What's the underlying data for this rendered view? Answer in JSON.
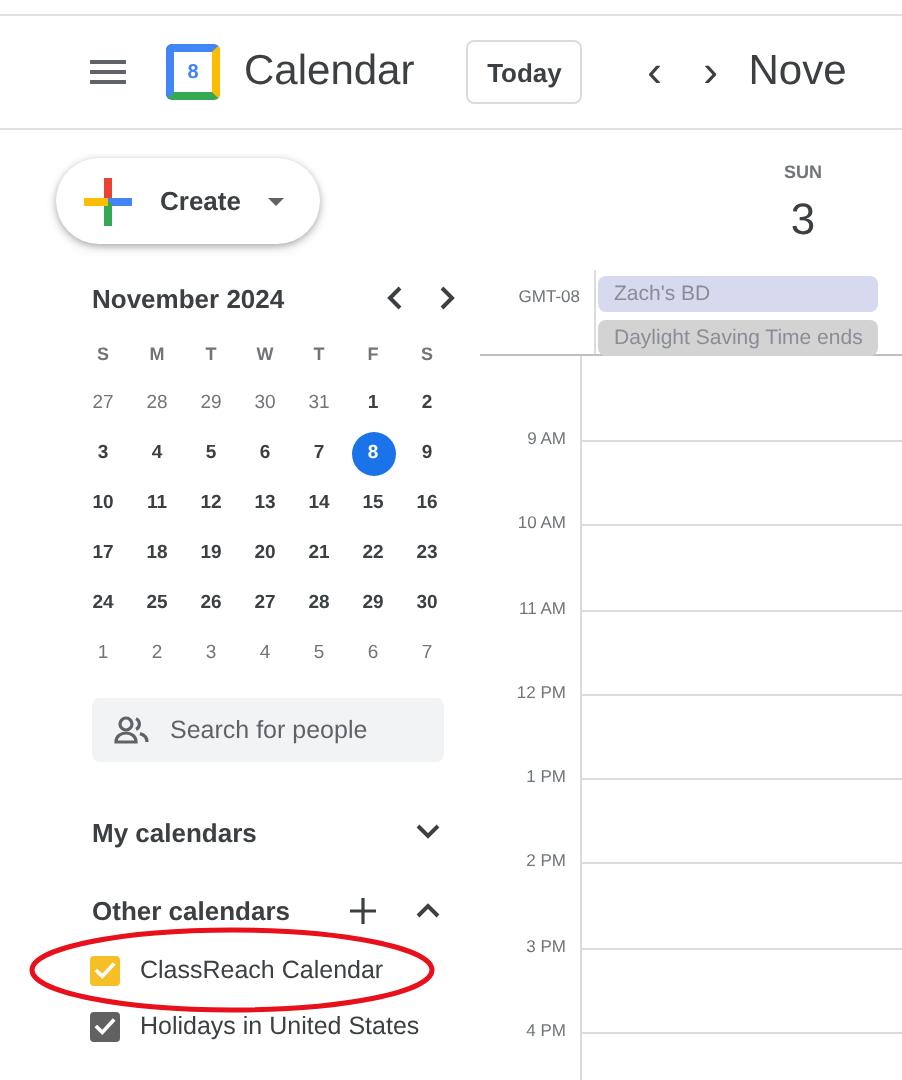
{
  "header": {
    "app_name": "Calendar",
    "logo_day": "8",
    "today_button": "Today",
    "prev": "‹",
    "next": "›",
    "period": "Nove"
  },
  "create_button": "Create",
  "mini_calendar": {
    "title": "November 2024",
    "weekdays": [
      "S",
      "M",
      "T",
      "W",
      "T",
      "F",
      "S"
    ],
    "weeks": [
      [
        {
          "d": "27",
          "other_month": true,
          "selected": false
        },
        {
          "d": "28",
          "other_month": true,
          "selected": false
        },
        {
          "d": "29",
          "other_month": true,
          "selected": false
        },
        {
          "d": "30",
          "other_month": true,
          "selected": false
        },
        {
          "d": "31",
          "other_month": true,
          "selected": false
        },
        {
          "d": "1",
          "other_month": false,
          "selected": false
        },
        {
          "d": "2",
          "other_month": false,
          "selected": false
        }
      ],
      [
        {
          "d": "3",
          "other_month": false,
          "selected": false
        },
        {
          "d": "4",
          "other_month": false,
          "selected": false
        },
        {
          "d": "5",
          "other_month": false,
          "selected": false
        },
        {
          "d": "6",
          "other_month": false,
          "selected": false
        },
        {
          "d": "7",
          "other_month": false,
          "selected": false
        },
        {
          "d": "8",
          "other_month": false,
          "selected": true
        },
        {
          "d": "9",
          "other_month": false,
          "selected": false
        }
      ],
      [
        {
          "d": "10",
          "other_month": false,
          "selected": false
        },
        {
          "d": "11",
          "other_month": false,
          "selected": false
        },
        {
          "d": "12",
          "other_month": false,
          "selected": false
        },
        {
          "d": "13",
          "other_month": false,
          "selected": false
        },
        {
          "d": "14",
          "other_month": false,
          "selected": false
        },
        {
          "d": "15",
          "other_month": false,
          "selected": false
        },
        {
          "d": "16",
          "other_month": false,
          "selected": false
        }
      ],
      [
        {
          "d": "17",
          "other_month": false,
          "selected": false
        },
        {
          "d": "18",
          "other_month": false,
          "selected": false
        },
        {
          "d": "19",
          "other_month": false,
          "selected": false
        },
        {
          "d": "20",
          "other_month": false,
          "selected": false
        },
        {
          "d": "21",
          "other_month": false,
          "selected": false
        },
        {
          "d": "22",
          "other_month": false,
          "selected": false
        },
        {
          "d": "23",
          "other_month": false,
          "selected": false
        }
      ],
      [
        {
          "d": "24",
          "other_month": false,
          "selected": false
        },
        {
          "d": "25",
          "other_month": false,
          "selected": false
        },
        {
          "d": "26",
          "other_month": false,
          "selected": false
        },
        {
          "d": "27",
          "other_month": false,
          "selected": false
        },
        {
          "d": "28",
          "other_month": false,
          "selected": false
        },
        {
          "d": "29",
          "other_month": false,
          "selected": false
        },
        {
          "d": "30",
          "other_month": false,
          "selected": false
        }
      ],
      [
        {
          "d": "1",
          "other_month": true,
          "selected": false
        },
        {
          "d": "2",
          "other_month": true,
          "selected": false
        },
        {
          "d": "3",
          "other_month": true,
          "selected": false
        },
        {
          "d": "4",
          "other_month": true,
          "selected": false
        },
        {
          "d": "5",
          "other_month": true,
          "selected": false
        },
        {
          "d": "6",
          "other_month": true,
          "selected": false
        },
        {
          "d": "7",
          "other_month": true,
          "selected": false
        }
      ]
    ]
  },
  "search": {
    "placeholder": "Search for people"
  },
  "my_calendars": {
    "label": "My calendars",
    "expanded": false
  },
  "other_calendars": {
    "label": "Other calendars",
    "expanded": true,
    "items": [
      {
        "name": "ClassReach Calendar",
        "checked": true,
        "color": "#f6bf26",
        "circled": true
      },
      {
        "name": "Holidays in United States",
        "checked": true,
        "color": "#616161",
        "circled": false
      }
    ]
  },
  "day": {
    "weekday": "SUN",
    "date": "3",
    "timezone": "GMT-08",
    "all_day_events": [
      {
        "title": "Zach's BD",
        "color": "#d7daee"
      },
      {
        "title": "Daylight Saving Time ends",
        "color": "#d3d3d3"
      }
    ],
    "hours": [
      "9 AM",
      "10 AM",
      "11 AM",
      "12 PM",
      "1 PM",
      "2 PM",
      "3 PM",
      "4 PM"
    ]
  }
}
